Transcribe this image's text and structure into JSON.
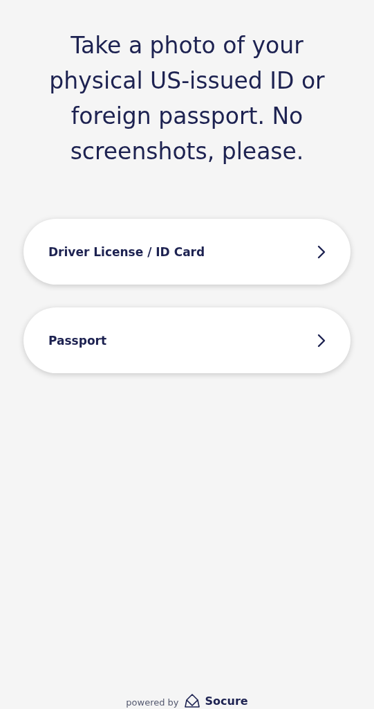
{
  "heading": "Take a photo of your physical US-issued ID or foreign passport. No screenshots, please.",
  "options": [
    {
      "label": "Driver License / ID Card"
    },
    {
      "label": "Passport"
    }
  ],
  "footer": {
    "prefix": "powered by",
    "brand": "Socure"
  }
}
